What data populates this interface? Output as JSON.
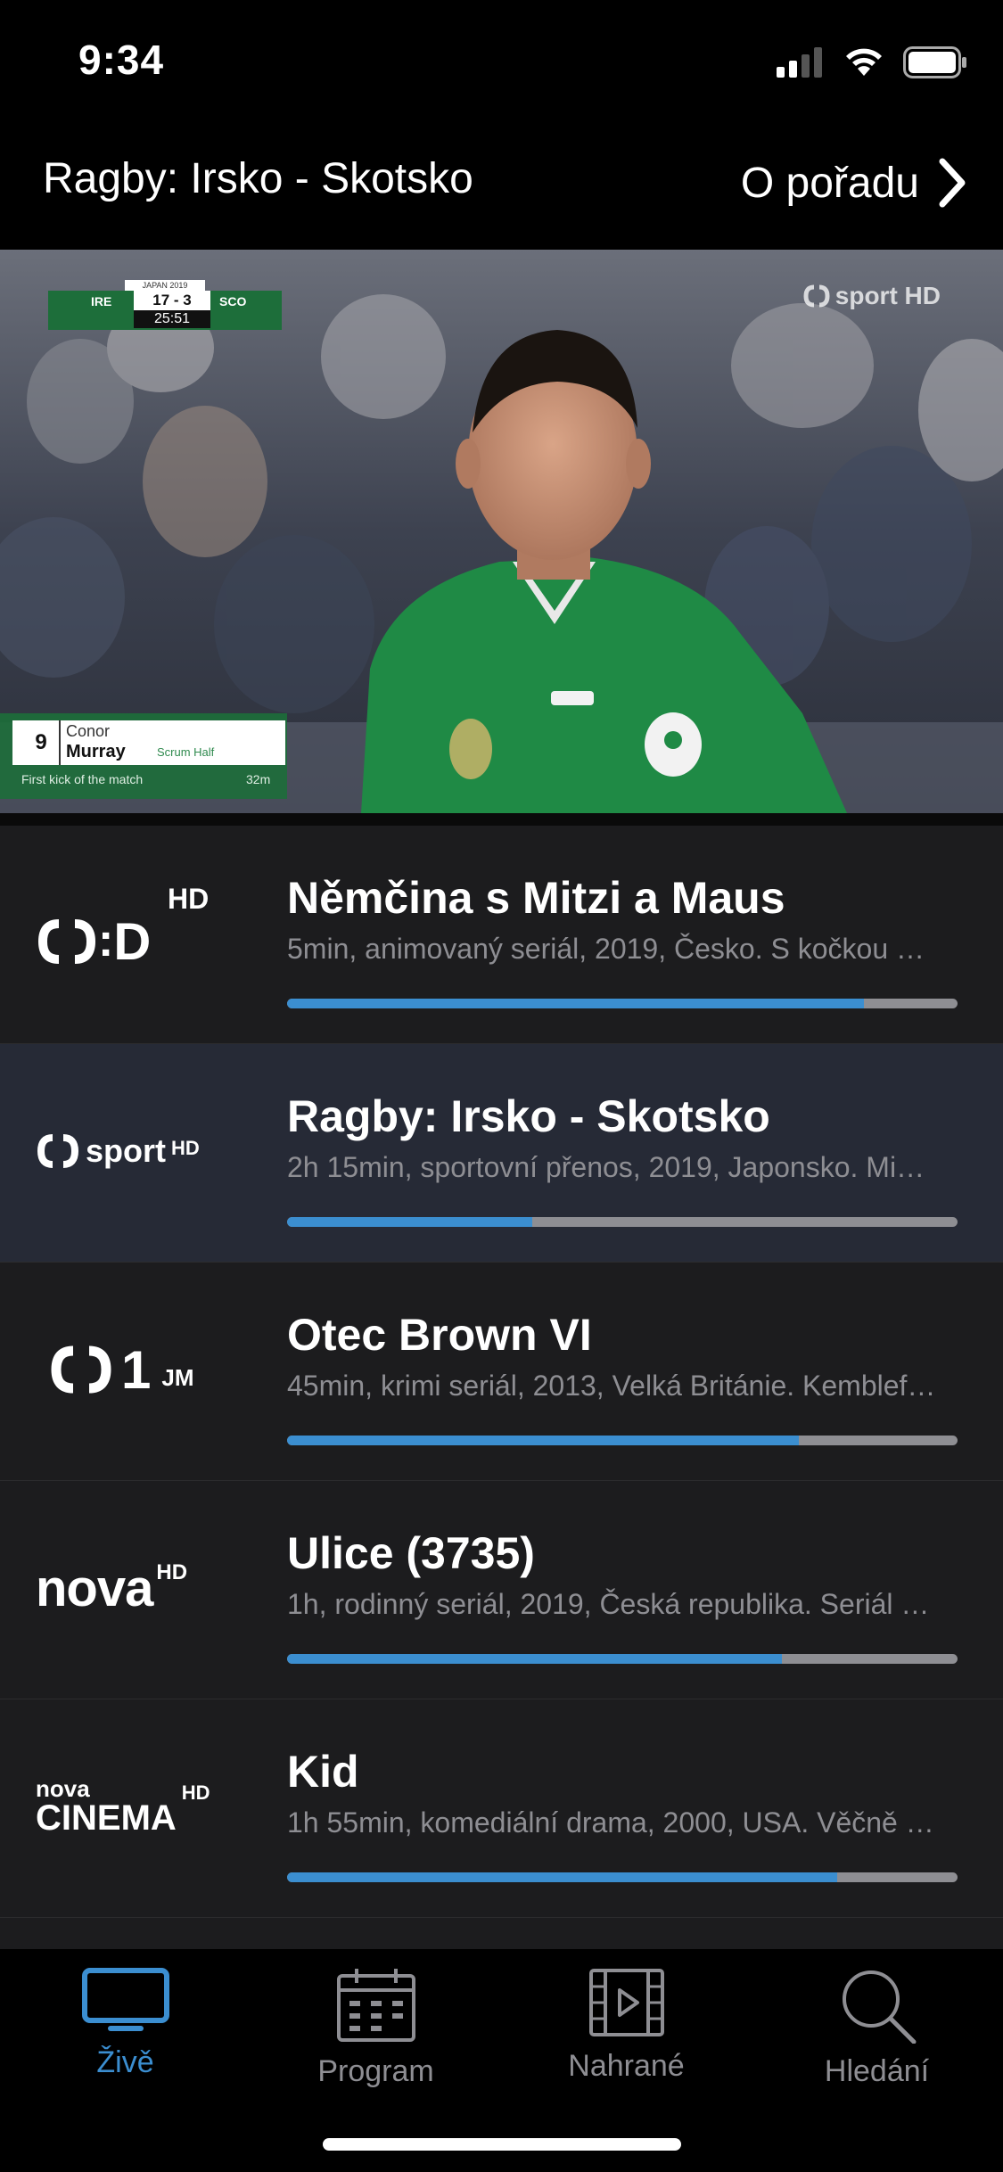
{
  "status_bar": {
    "time": "9:34"
  },
  "header": {
    "title": "Ragby: Irsko - Skotsko",
    "about_label": "O pořadu"
  },
  "player": {
    "score_banner": {
      "tournament": "JAPAN 2019",
      "team_home": "IRE",
      "score": "17 - 3",
      "team_away": "SCO",
      "clock": "25:51"
    },
    "channel_watermark": "sport HD",
    "lower_third": {
      "number": "9",
      "first_name": "Conor",
      "last_name": "Murray",
      "position": "Scrum Half",
      "caption": "First kick of the match",
      "minute": "32m"
    }
  },
  "channels": [
    {
      "logo_text": "ČT:D",
      "logo_badge": "HD",
      "title": "Němčina s Mitzi a Maus",
      "meta": "5min, animovaný seriál, 2019, Česko. S kočkou Mitzi a myškou Maus",
      "progress": 0.86,
      "active": false
    },
    {
      "logo_text": "sport",
      "logo_badge": "HD",
      "title": "Ragby: Irsko - Skotsko",
      "meta": "2h 15min, sportovní přenos, 2019, Japonsko. Mistrovství světa v ragby",
      "progress": 0.366,
      "active": true
    },
    {
      "logo_text": "1",
      "logo_badge": "JM",
      "title": "Otec Brown VI",
      "meta": "45min, krimi seriál, 2013, Velká Británie. Kembleford",
      "progress": 0.763,
      "active": false
    },
    {
      "logo_text": "nova",
      "logo_badge": "HD",
      "title": "Ulice (3735)",
      "meta": "1h, rodinný seriál, 2019, Česká republika. Seriál Ulice",
      "progress": 0.738,
      "active": false
    },
    {
      "logo_text_top": "nova",
      "logo_text": "CINEMA",
      "logo_badge": "HD",
      "title": "Kid",
      "meta": "1h 55min, komediální drama, 2000, USA. Věčně zaneprázdněný",
      "progress": 0.82,
      "active": false
    }
  ],
  "tabbar": {
    "tabs": [
      {
        "label": "Živě",
        "icon": "tv-icon",
        "active": true
      },
      {
        "label": "Program",
        "icon": "calendar-icon",
        "active": false
      },
      {
        "label": "Nahrané",
        "icon": "film-icon",
        "active": false
      },
      {
        "label": "Hledání",
        "icon": "search-icon",
        "active": false
      }
    ]
  },
  "colors": {
    "accent": "#3b8ed0",
    "list_background": "#1c1c1e",
    "active_row": "#262a36",
    "muted_text": "#8e8e93"
  }
}
